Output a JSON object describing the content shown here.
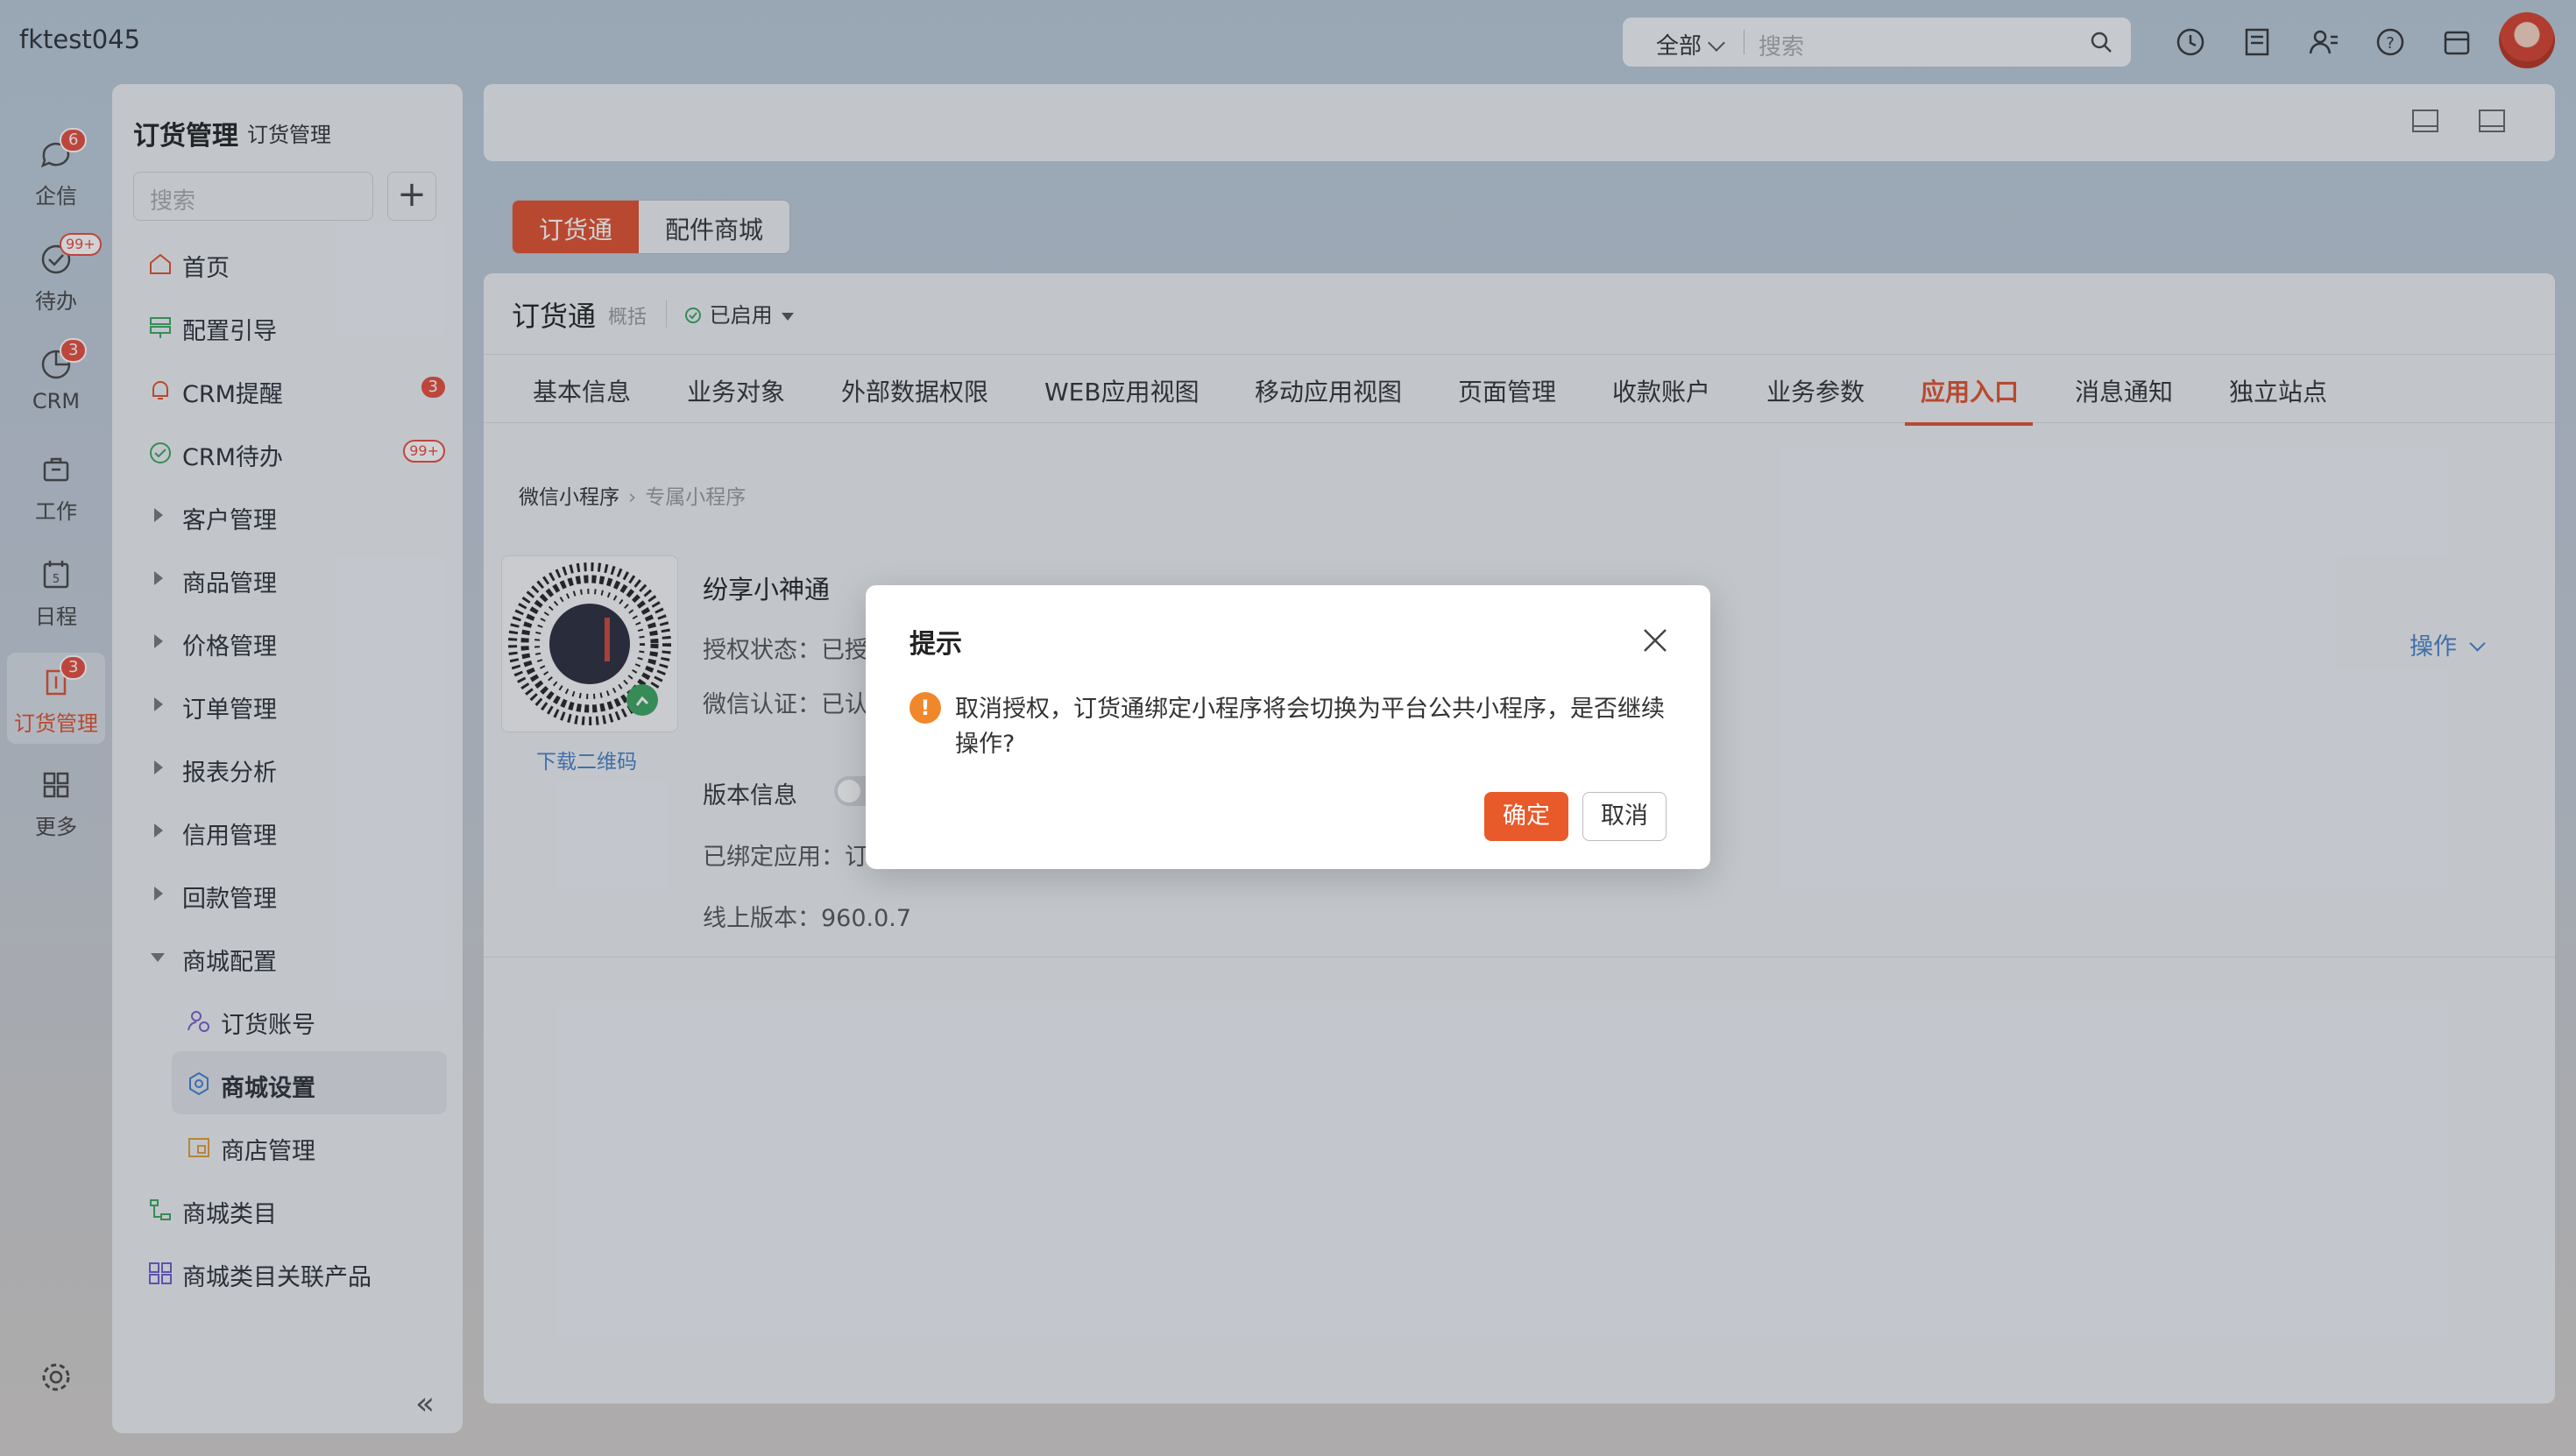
{
  "account": "fktest045",
  "search": {
    "scope": "全部",
    "placeholder": "搜索"
  },
  "nav": [
    {
      "label": "企信",
      "badge": "6"
    },
    {
      "label": "待办",
      "badge": "99+"
    },
    {
      "label": "CRM",
      "badge": "3"
    },
    {
      "label": "工作"
    },
    {
      "label": "日程",
      "day": "5"
    },
    {
      "label": "订货管理",
      "badge": "3"
    },
    {
      "label": "更多"
    }
  ],
  "sidebar": {
    "title": "订货管理",
    "subtitle": "订货管理",
    "search_placeholder": "搜索",
    "add": "+",
    "items": [
      {
        "label": "首页"
      },
      {
        "label": "配置引导"
      },
      {
        "label": "CRM提醒",
        "badge": "3"
      },
      {
        "label": "CRM待办",
        "badge": "99+"
      },
      {
        "label": "客户管理"
      },
      {
        "label": "商品管理"
      },
      {
        "label": "价格管理"
      },
      {
        "label": "订单管理"
      },
      {
        "label": "报表分析"
      },
      {
        "label": "信用管理"
      },
      {
        "label": "回款管理"
      },
      {
        "label": "商城配置"
      },
      {
        "label": "订货账号"
      },
      {
        "label": "商城设置"
      },
      {
        "label": "商店管理"
      },
      {
        "label": "商城类目"
      },
      {
        "label": "商城类目关联产品"
      }
    ]
  },
  "seg_tabs": [
    "订货通",
    "配件商城"
  ],
  "panel": {
    "title": "订货通",
    "subtitle": "概括",
    "status": "已启用",
    "tabs": [
      "基本信息",
      "业务对象",
      "外部数据权限",
      "WEB应用视图",
      "移动应用视图",
      "页面管理",
      "收款账户",
      "业务参数",
      "应用入口",
      "消息通知",
      "独立站点"
    ],
    "active_tab": "应用入口",
    "breadcrumb": [
      "微信小程序",
      "专属小程序"
    ],
    "qr_download": "下载二维码",
    "app_name": "纷享小神通",
    "auth_status": "授权状态：已授",
    "wx_cert": "微信认证：已认",
    "version_info": "版本信息",
    "bound_app": "已绑定应用：订",
    "online_version": "线上版本：960.0.7",
    "ops": "操作"
  },
  "dialog": {
    "title": "提示",
    "message": "取消授权，订货通绑定小程序将会切换为平台公共小程序，是否继续操作?",
    "confirm": "确定",
    "cancel": "取消"
  },
  "colors": {
    "accent": "#e0502c",
    "link": "#4a7fc4",
    "warn": "#f0882b"
  }
}
